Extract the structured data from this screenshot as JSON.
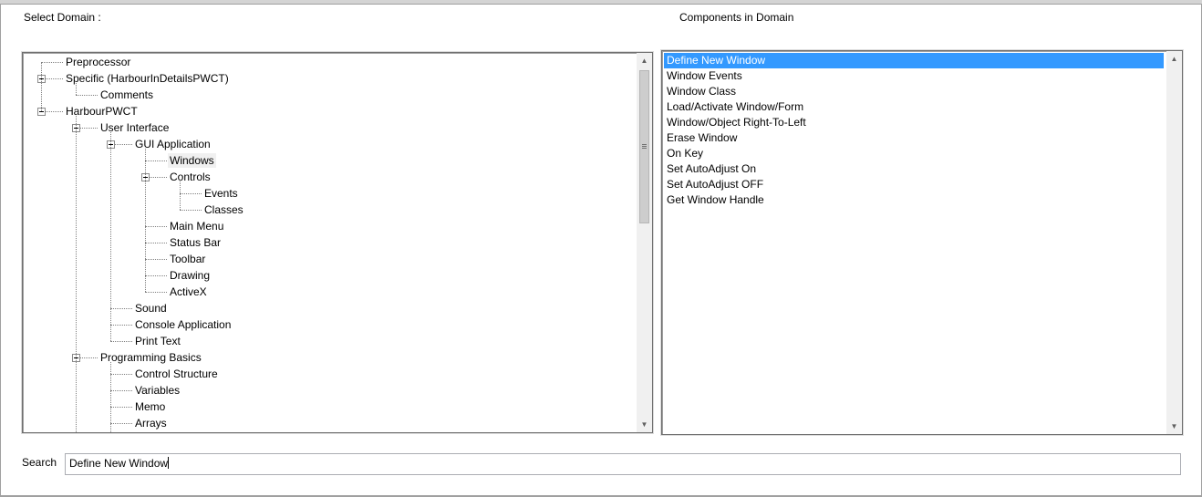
{
  "select_domain_label": "Select Domain :",
  "components_label": "Components in Domain",
  "search_label": "Search",
  "search_value": "Define New Window",
  "tree": [
    {
      "label": "Preprocessor",
      "level": 0,
      "expander": false,
      "selected": false
    },
    {
      "label": "Specific (HarbourInDetailsPWCT)",
      "level": 0,
      "expander": true,
      "selected": false
    },
    {
      "label": "Comments",
      "level": 1,
      "expander": false,
      "selected": false
    },
    {
      "label": "HarbourPWCT",
      "level": 0,
      "expander": true,
      "selected": false
    },
    {
      "label": "User Interface",
      "level": 1,
      "expander": true,
      "selected": false
    },
    {
      "label": "GUI Application",
      "level": 2,
      "expander": true,
      "selected": false
    },
    {
      "label": "Windows",
      "level": 3,
      "expander": false,
      "selected": true
    },
    {
      "label": "Controls",
      "level": 3,
      "expander": true,
      "selected": false
    },
    {
      "label": "Events",
      "level": 4,
      "expander": false,
      "selected": false
    },
    {
      "label": "Classes",
      "level": 4,
      "expander": false,
      "selected": false
    },
    {
      "label": "Main Menu",
      "level": 3,
      "expander": false,
      "selected": false
    },
    {
      "label": "Status Bar",
      "level": 3,
      "expander": false,
      "selected": false
    },
    {
      "label": "Toolbar",
      "level": 3,
      "expander": false,
      "selected": false
    },
    {
      "label": "Drawing",
      "level": 3,
      "expander": false,
      "selected": false
    },
    {
      "label": "ActiveX",
      "level": 3,
      "expander": false,
      "selected": false
    },
    {
      "label": "Sound",
      "level": 2,
      "expander": false,
      "selected": false
    },
    {
      "label": "Console Application",
      "level": 2,
      "expander": false,
      "selected": false
    },
    {
      "label": "Print Text",
      "level": 2,
      "expander": false,
      "selected": false
    },
    {
      "label": "Programming Basics",
      "level": 1,
      "expander": true,
      "selected": false
    },
    {
      "label": "Control Structure",
      "level": 2,
      "expander": false,
      "selected": false
    },
    {
      "label": "Variables",
      "level": 2,
      "expander": false,
      "selected": false
    },
    {
      "label": "Memo",
      "level": 2,
      "expander": false,
      "selected": false
    },
    {
      "label": "Arrays",
      "level": 2,
      "expander": false,
      "selected": false
    }
  ],
  "components": [
    {
      "label": "Define New Window",
      "selected": true
    },
    {
      "label": "Window Events",
      "selected": false
    },
    {
      "label": "Window Class",
      "selected": false
    },
    {
      "label": "Load/Activate Window/Form",
      "selected": false
    },
    {
      "label": "Window/Object Right-To-Left",
      "selected": false
    },
    {
      "label": "Erase Window",
      "selected": false
    },
    {
      "label": "On Key",
      "selected": false
    },
    {
      "label": "Set AutoAdjust On",
      "selected": false
    },
    {
      "label": "Set AutoAdjust OFF",
      "selected": false
    },
    {
      "label": "Get Window Handle",
      "selected": false
    }
  ],
  "icons": {
    "scroll_up": "▲",
    "scroll_down": "▼"
  }
}
